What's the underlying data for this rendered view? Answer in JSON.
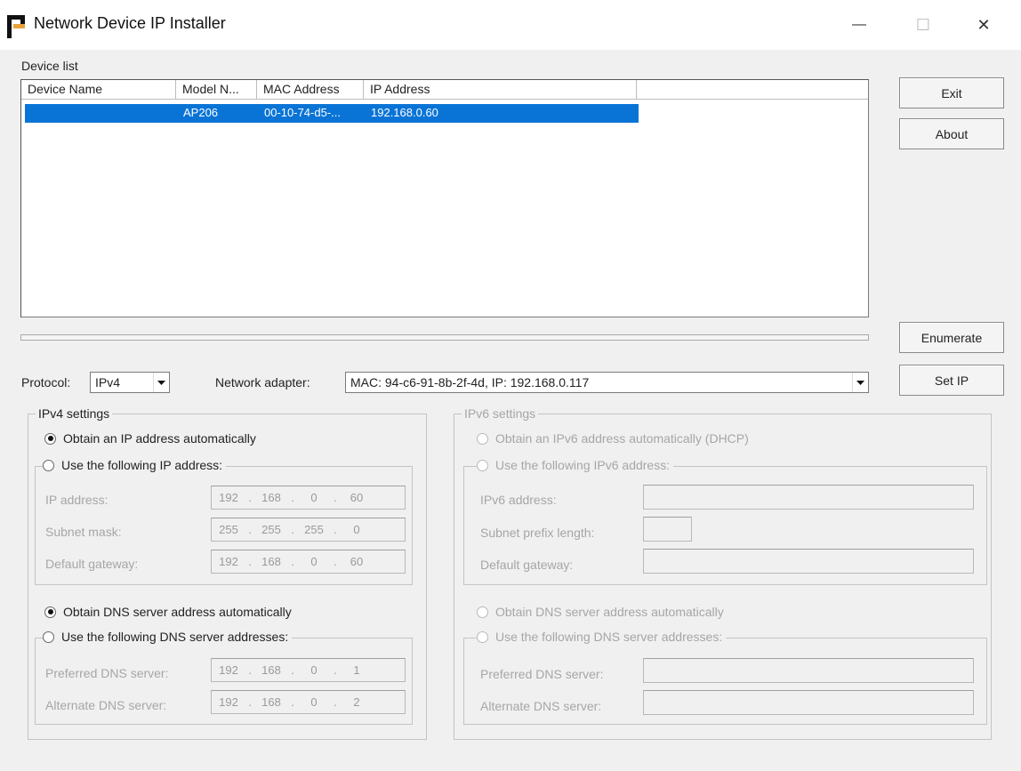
{
  "window": {
    "title": "Network Device IP Installer",
    "controls": {
      "minimize": "—",
      "maximize": "☐",
      "close": "✕"
    }
  },
  "device_list": {
    "label": "Device list",
    "columns": [
      "Device Name",
      "Model N...",
      "MAC Address",
      "IP Address",
      ""
    ],
    "rows": [
      {
        "device_name": "",
        "model": "AP206",
        "mac": "00-10-74-d5-...",
        "ip": "192.168.0.60",
        "selected": true
      }
    ]
  },
  "buttons": {
    "exit": "Exit",
    "about": "About",
    "enumerate": "Enumerate",
    "set_ip": "Set IP"
  },
  "progress": {
    "value": 0
  },
  "protocol": {
    "label": "Protocol:",
    "value": "IPv4"
  },
  "network_adapter": {
    "label": "Network adapter:",
    "value": "MAC: 94-c6-91-8b-2f-4d,  IP: 192.168.0.117"
  },
  "ipv4": {
    "group_label": "IPv4 settings",
    "obtain_ip_auto": "Obtain an IP address automatically",
    "use_following_ip": "Use the following IP address:",
    "ip_address_label": "IP address:",
    "ip_address": [
      "192",
      "168",
      "0",
      "60"
    ],
    "subnet_mask_label": "Subnet mask:",
    "subnet_mask": [
      "255",
      "255",
      "255",
      "0"
    ],
    "default_gateway_label": "Default gateway:",
    "default_gateway": [
      "192",
      "168",
      "0",
      "60"
    ],
    "obtain_dns_auto": "Obtain DNS server address automatically",
    "use_following_dns": "Use the following DNS server addresses:",
    "preferred_dns_label": "Preferred DNS server:",
    "preferred_dns": [
      "192",
      "168",
      "0",
      "1"
    ],
    "alternate_dns_label": "Alternate DNS server:",
    "alternate_dns": [
      "192",
      "168",
      "0",
      "2"
    ]
  },
  "ipv6": {
    "group_label": "IPv6 settings",
    "obtain_ip_auto": "Obtain an IPv6 address automatically (DHCP)",
    "use_following_ip": "Use the following IPv6 address:",
    "ipv6_address_label": "IPv6 address:",
    "subnet_prefix_label": "Subnet prefix length:",
    "default_gateway_label": "Default gateway:",
    "obtain_dns_auto": "Obtain DNS server address automatically",
    "use_following_dns": "Use the following DNS server addresses:",
    "preferred_dns_label": "Preferred DNS server:",
    "alternate_dns_label": "Alternate DNS server:"
  },
  "colors": {
    "selection": "#0a74d6",
    "disabled_text": "#a6a6a6",
    "background": "#f0f0f0"
  }
}
